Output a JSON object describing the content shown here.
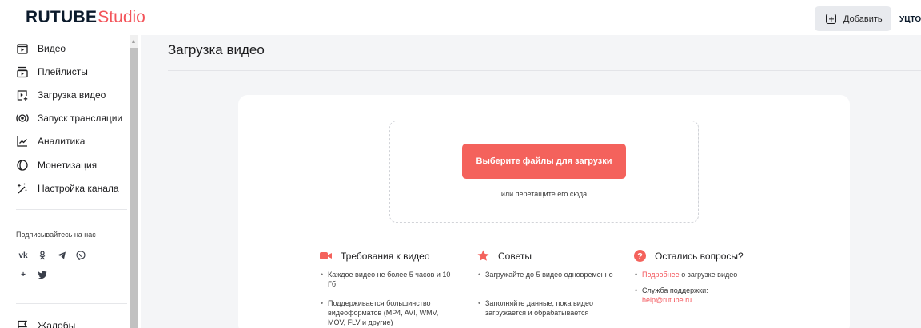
{
  "header": {
    "logo_main": "RUTUBE",
    "logo_sub": "Studio",
    "add_button": "Добавить",
    "avatar_text": "УЦТО"
  },
  "sidebar": {
    "items": [
      {
        "label": "Видео",
        "icon": "video-icon"
      },
      {
        "label": "Плейлисты",
        "icon": "playlist-icon"
      },
      {
        "label": "Загрузка видео",
        "icon": "upload-video-icon"
      },
      {
        "label": "Запуск трансляции",
        "icon": "broadcast-icon"
      },
      {
        "label": "Аналитика",
        "icon": "analytics-icon"
      },
      {
        "label": "Монетизация",
        "icon": "monetization-icon"
      },
      {
        "label": "Настройка канала",
        "icon": "magic-wand-icon"
      }
    ],
    "follow_title": "Подписывайтесь на нас",
    "socials": [
      "vk-icon",
      "odnoklassniki-icon",
      "telegram-icon",
      "viber-icon",
      "dzen-icon",
      "twitter-icon"
    ],
    "socials_text": {
      "vk": "vk",
      "plus": "+"
    },
    "bottom_item": {
      "label": "Жалобы",
      "icon": "flag-icon"
    }
  },
  "main": {
    "title": "Загрузка видео",
    "upload_button": "Выберите файлы для загрузки",
    "drop_hint": "или перетащите его сюда",
    "requirements": {
      "title": "Требования к видео",
      "items": [
        "Каждое видео не более 5 часов и 10 Гб",
        "Поддерживается большинство видеоформатов (MP4, AVI, WMV, MOV, FLV и другие)"
      ]
    },
    "tips": {
      "title": "Советы",
      "items": [
        "Загружайте до 5 видео одновременно",
        "Заполняйте данные, пока видео загружается и обрабатывается"
      ]
    },
    "questions": {
      "title": "Остались вопросы?",
      "more_link": "Подробнее",
      "more_text": " о загрузке видео",
      "support_label": "Служба поддержки:",
      "support_email": "help@rutube.ru"
    }
  },
  "colors": {
    "accent": "#f4625c",
    "background": "#f4f5f7",
    "logo_dark": "#0b1a2b"
  }
}
